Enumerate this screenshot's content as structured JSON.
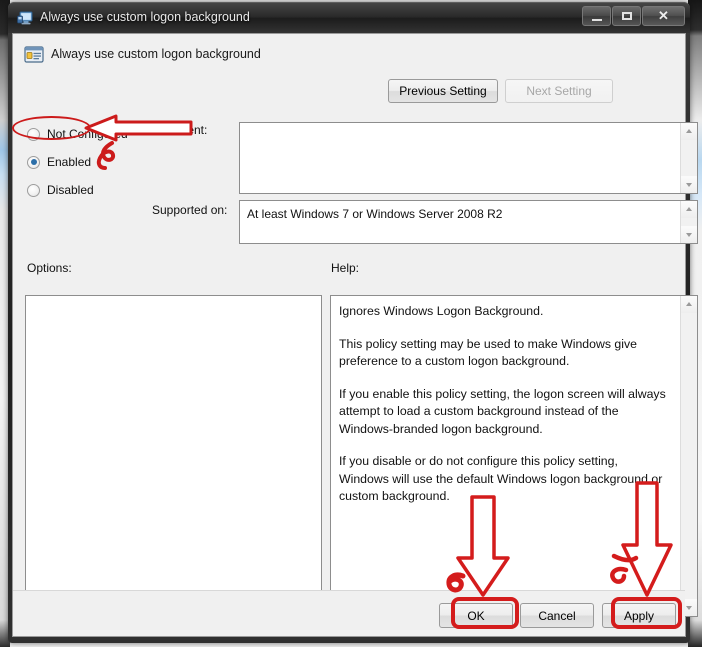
{
  "window": {
    "title": "Always use custom logon background",
    "title_icon": "computer-monitor-icon",
    "minimize_label": "",
    "maximize_label": "",
    "close_label": "✕"
  },
  "header": {
    "icon": "group-policy-setting-icon",
    "title": "Always use custom logon background"
  },
  "navigation": {
    "previous_setting": "Previous Setting",
    "next_setting": "Next Setting",
    "next_setting_enabled": false
  },
  "state_options": [
    {
      "label": "Not Configured",
      "selected": false
    },
    {
      "label": "Enabled",
      "selected": true
    },
    {
      "label": "Disabled",
      "selected": false
    }
  ],
  "fields": {
    "comment_label": "Comment:",
    "comment_value": "",
    "supported_label": "Supported on:",
    "supported_value": "At least Windows 7 or Windows Server 2008 R2"
  },
  "panels": {
    "options_label": "Options:",
    "options_content": "",
    "help_label": "Help:",
    "help_paragraphs": [
      "Ignores Windows Logon Background.",
      "This policy setting may be used to make Windows give preference to a custom logon background.",
      "If you enable this policy setting, the logon screen will always attempt to load a custom background instead of the Windows-branded logon background.",
      "If you disable or do not configure this policy setting, Windows will use the default Windows logon background or custom background."
    ]
  },
  "footer": {
    "ok": "OK",
    "cancel": "Cancel",
    "apply": "Apply"
  },
  "annotations": {
    "color": "#cc1b1b",
    "marks": [
      "ellipse-around-enabled-radio",
      "left-arrow-pointing-at-enabled",
      "squiggle-below-enabled-arrow",
      "down-arrow-pointing-at-ok",
      "spiral-left-of-ok",
      "red-box-around-ok",
      "down-arrow-pointing-at-apply",
      "squiggle-left-of-apply",
      "red-box-around-apply"
    ]
  }
}
